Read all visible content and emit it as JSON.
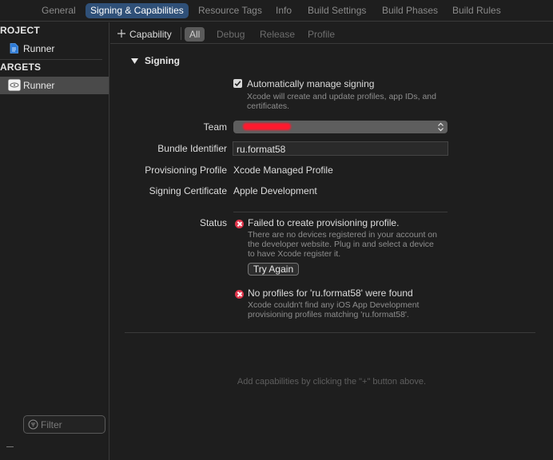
{
  "top_tabs": [
    "General",
    "Signing & Capabilities",
    "Resource Tags",
    "Info",
    "Build Settings",
    "Build Phases",
    "Build Rules"
  ],
  "sidebar": {
    "project_header": "ROJECT",
    "project_item": "Runner",
    "targets_header": "ARGETS",
    "target_item": "Runner",
    "filter_placeholder": "Filter"
  },
  "capbar": {
    "add_capability": "Capability",
    "configs": [
      "All",
      "Debug",
      "Release",
      "Profile"
    ]
  },
  "signing": {
    "section_title": "Signing",
    "auto_manage_label": "Automatically manage signing",
    "auto_manage_checked": true,
    "auto_manage_desc_1": "Xcode will create and update profiles, app IDs, and",
    "auto_manage_desc_2": "certificates.",
    "team_label": "Team",
    "bundle_id_label": "Bundle Identifier",
    "bundle_id_value": "ru.format58",
    "prov_profile_label": "Provisioning Profile",
    "prov_profile_value": "Xcode Managed Profile",
    "signing_cert_label": "Signing Certificate",
    "signing_cert_value": "Apple Development",
    "status_label": "Status",
    "error1_title": "Failed to create provisioning profile.",
    "error1_desc_1": "There are no devices registered in your account on",
    "error1_desc_2": "the developer website. Plug in and select a device",
    "error1_desc_3": "to have Xcode register it.",
    "try_again": "Try Again",
    "error2_title": "No profiles for 'ru.format58' were found",
    "error2_desc_1": "Xcode couldn't find any iOS App Development",
    "error2_desc_2": "provisioning profiles matching 'ru.format58'."
  },
  "empty_hint": "Add capabilities by clicking the \"+\" button above.",
  "colors": {
    "accent": "#2f5078",
    "error": "#e0354b",
    "redaction": "#ff1a2e"
  }
}
